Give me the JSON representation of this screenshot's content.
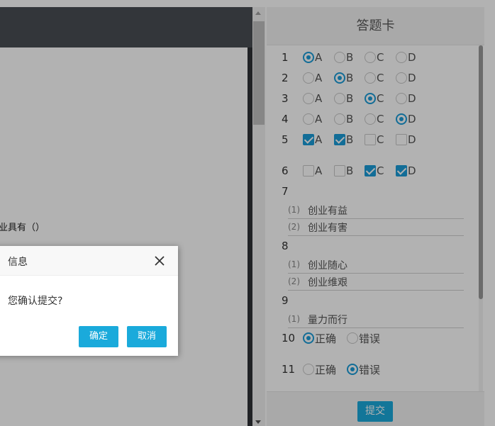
{
  "exam": {
    "question_text": "业具有（）"
  },
  "answer_card": {
    "title": "答题卡",
    "submit_label": "提交",
    "questions": [
      {
        "number": "1",
        "type": "single",
        "options": [
          "A",
          "B",
          "C",
          "D"
        ],
        "selected": [
          "A"
        ]
      },
      {
        "number": "2",
        "type": "single",
        "options": [
          "A",
          "B",
          "C",
          "D"
        ],
        "selected": [
          "B"
        ]
      },
      {
        "number": "3",
        "type": "single",
        "options": [
          "A",
          "B",
          "C",
          "D"
        ],
        "selected": [
          "C"
        ]
      },
      {
        "number": "4",
        "type": "single",
        "options": [
          "A",
          "B",
          "C",
          "D"
        ],
        "selected": [
          "D"
        ]
      },
      {
        "number": "5",
        "type": "multiple",
        "options": [
          "A",
          "B",
          "C",
          "D"
        ],
        "selected": [
          "A",
          "B"
        ]
      },
      {
        "number": "6",
        "type": "multiple",
        "options": [
          "A",
          "B",
          "C",
          "D"
        ],
        "selected": [
          "C",
          "D"
        ]
      },
      {
        "number": "7",
        "type": "blank",
        "blanks": [
          {
            "index": "(1)",
            "value": "创业有益"
          },
          {
            "index": "(2)",
            "value": "创业有害"
          }
        ]
      },
      {
        "number": "8",
        "type": "blank",
        "blanks": [
          {
            "index": "(1)",
            "value": "创业随心"
          },
          {
            "index": "(2)",
            "value": "创业维艰"
          }
        ]
      },
      {
        "number": "9",
        "type": "blank",
        "blanks": [
          {
            "index": "(1)",
            "value": "量力而行"
          }
        ]
      },
      {
        "number": "10",
        "type": "judge",
        "options": [
          "正确",
          "错误"
        ],
        "selected": [
          "正确"
        ]
      },
      {
        "number": "11",
        "type": "judge",
        "options": [
          "正确",
          "错误"
        ],
        "selected": [
          "错误"
        ]
      }
    ]
  },
  "dialog": {
    "title": "信息",
    "message": "您确认提交?",
    "confirm_label": "确定",
    "cancel_label": "取消"
  },
  "colors": {
    "accent": "#1a9cd8",
    "button": "#1aaadb",
    "overlay": "rgba(0,0,0,0.30)"
  },
  "icons": {
    "close": "close-icon",
    "scroll_up": "scroll-up-arrow-icon",
    "scroll_down": "scroll-down-arrow-icon"
  }
}
